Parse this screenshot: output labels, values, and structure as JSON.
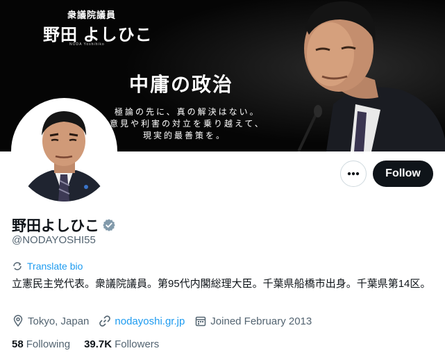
{
  "banner": {
    "role": "衆議院議員",
    "name": "野田 よしひこ",
    "romaji": "NODA Yoshihiko",
    "slogan": "中庸の政治",
    "lines": [
      "極論の先に、真の解決はない。",
      "意見や利害の対立を乗り越えて、",
      "現実的最善策を。"
    ]
  },
  "profile": {
    "display_name": "野田よしひこ",
    "handle": "@NODAYOSHI55",
    "translate_label": "Translate bio",
    "bio": "立憲民主党代表。衆議院議員。第95代内閣総理大臣。千葉県船橋市出身。千葉県第14区。",
    "location": "Tokyo, Japan",
    "website": "nodayoshi.gr.jp",
    "joined": "Joined February 2013"
  },
  "actions": {
    "follow_label": "Follow"
  },
  "stats": {
    "following_count": "58",
    "following_label": "Following",
    "followers_count": "39.7K",
    "followers_label": "Followers"
  },
  "colors": {
    "accent": "#1d9bf0",
    "text_primary": "#0f1419",
    "text_secondary": "#536471",
    "verified_badge": "#829aab",
    "follow_bg": "#0f1419"
  },
  "icons": [
    "more-icon",
    "verified-badge-icon",
    "translate-icon",
    "location-icon",
    "link-icon",
    "calendar-icon"
  ]
}
